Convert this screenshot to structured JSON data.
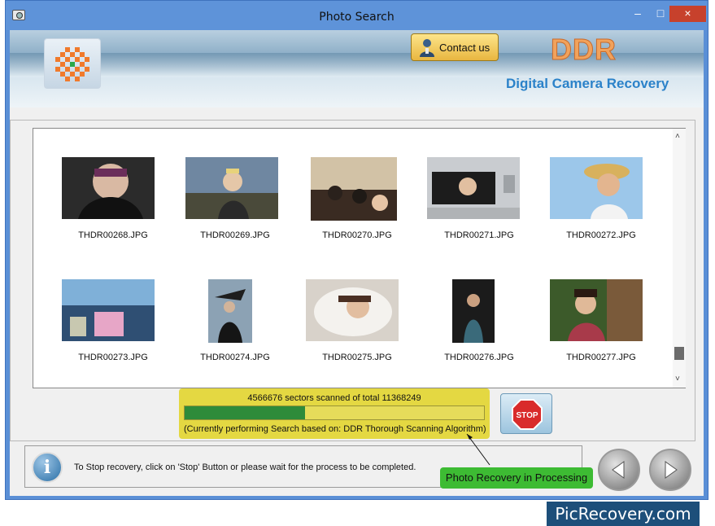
{
  "window": {
    "title": "Photo Search",
    "minimize": "–",
    "maximize": "□",
    "close": "×"
  },
  "header": {
    "contact_label": "Contact us",
    "brand": "DDR",
    "product": "Digital Camera Recovery"
  },
  "gallery": {
    "row1": [
      "THDR00268.JPG",
      "THDR00269.JPG",
      "THDR00270.JPG",
      "THDR00271.JPG",
      "THDR00272.JPG"
    ],
    "row2": [
      "THDR00273.JPG",
      "THDR00274.JPG",
      "THDR00275.JPG",
      "THDR00276.JPG",
      "THDR00277.JPG"
    ],
    "scroll_up": "˄",
    "scroll_down": "˅"
  },
  "progress": {
    "sectors_text": "4566676 sectors scanned of total 11368249",
    "algorithm_text": "(Currently performing Search based on:  DDR Thorough Scanning Algorithm)",
    "scanned": 4566676,
    "total": 11368249
  },
  "stop": {
    "label": "STOP",
    "color": "#d92b2b"
  },
  "status": {
    "message": "To Stop recovery, click on 'Stop' Button or please wait for the process to be completed.",
    "info_symbol": "i",
    "processing_label": "Photo Recovery in Processing"
  },
  "watermark": {
    "text": "PicRecovery.com"
  },
  "colors": {
    "progress_fill": "#2e8b3a",
    "processing_badge": "#3dbb33",
    "brand": "#f1a25c",
    "product": "#2b82c9"
  }
}
